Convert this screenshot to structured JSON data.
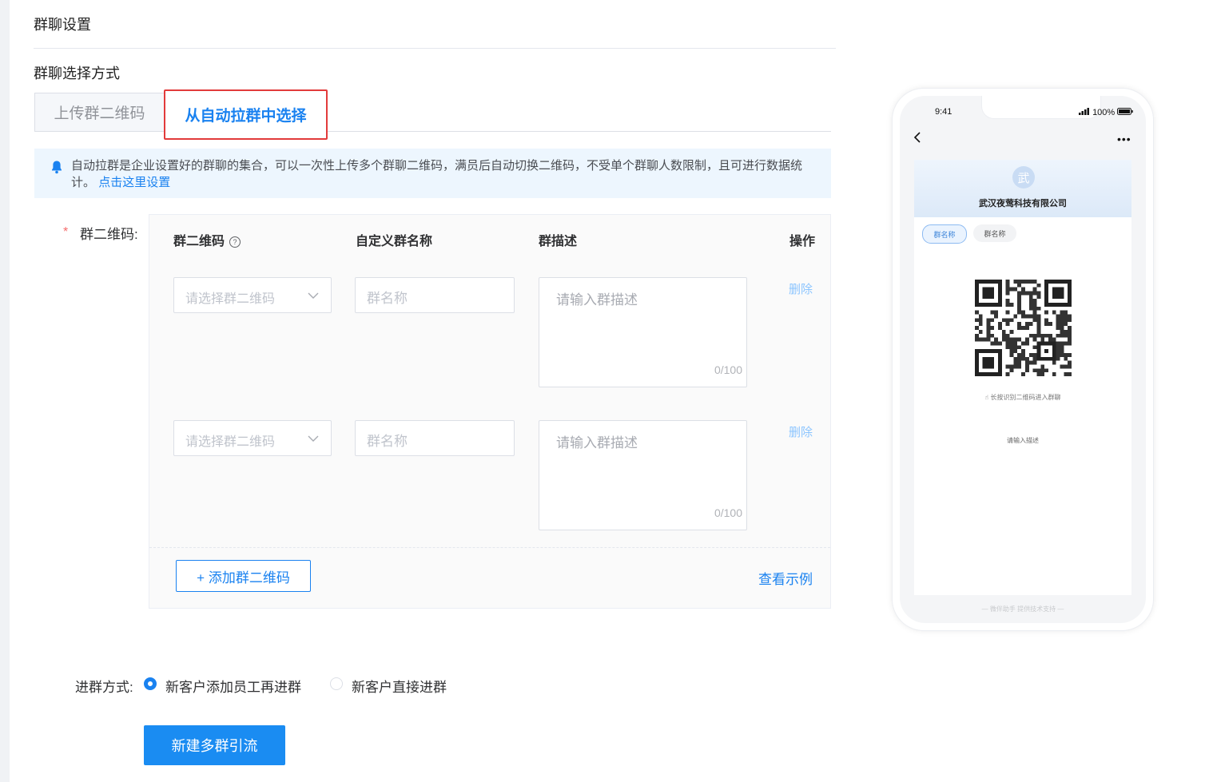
{
  "section_title": "群聊设置",
  "select_method_label": "群聊选择方式",
  "tabs": [
    {
      "label": "上传群二维码",
      "active": false
    },
    {
      "label": "从自动拉群中选择",
      "active": true
    }
  ],
  "notice": {
    "text": "自动拉群是企业设置好的群聊的集合，可以一次性上传多个群聊二维码，满员后自动切换二维码，不受单个群聊人数限制，且可进行数据统计。",
    "link": "点击这里设置",
    "icon": "bell-icon"
  },
  "field": {
    "required_mark": "*",
    "label": "群二维码:"
  },
  "table": {
    "headers": {
      "qr": "群二维码",
      "help_icon": "?",
      "name": "自定义群名称",
      "desc": "群描述",
      "action": "操作"
    },
    "rows": [
      {
        "select_placeholder": "请选择群二维码",
        "name_placeholder": "群名称",
        "desc_placeholder": "请输入群描述",
        "count": "0/100",
        "delete": "删除"
      },
      {
        "select_placeholder": "请选择群二维码",
        "name_placeholder": "群名称",
        "desc_placeholder": "请输入群描述",
        "count": "0/100",
        "delete": "删除"
      }
    ],
    "add_button": "+ 添加群二维码",
    "view_example": "查看示例"
  },
  "entry": {
    "label": "进群方式:",
    "options": [
      {
        "label": "新客户添加员工再进群",
        "selected": true
      },
      {
        "label": "新客户直接进群",
        "selected": false
      }
    ]
  },
  "submit_button": "新建多群引流",
  "phone": {
    "time": "9:41",
    "battery": "100%",
    "more": "•••",
    "avatar_char": "武",
    "company": "武汉夜莺科技有限公司",
    "chips": [
      "群名称",
      "群名称"
    ],
    "qr_hint": "长按识别二维码进入群聊",
    "description": "请输入描述",
    "footer": "— 微伴助手 提供技术支持 —"
  },
  "colors": {
    "primary": "#1a82f0",
    "highlight_border": "#e23b3b",
    "notice_bg": "#edf6fe",
    "required": "#f56c6c"
  }
}
